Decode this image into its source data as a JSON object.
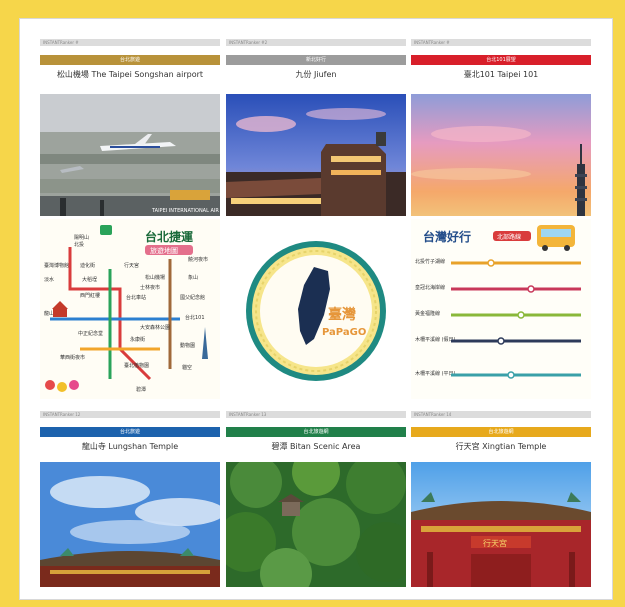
{
  "colors": {
    "page_bg": "#f6d64a",
    "gold": "#b8923a",
    "gray": "#9c9c9c",
    "red": "#d81f2a",
    "blue": "#1c62ad",
    "green": "#21804a",
    "yellow": "#e7a91c"
  },
  "row1": [
    {
      "meta": "INSTANTRanker #",
      "badge": "台北旅遊",
      "title": "松山機場 The Taipei Songshan airport"
    },
    {
      "meta": "INSTANTRanker #2",
      "badge": "新北好行",
      "title": "九份 Jiufen"
    },
    {
      "meta": "INSTANTRanker #",
      "badge": "台北101展望",
      "title": "臺北101 Taipei 101"
    }
  ],
  "airport_sign": "TAIPEI INTERNATIONAL AIR",
  "metro": {
    "title": "台北捷運",
    "subtitle": "旅遊地圖",
    "stations": [
      "陽明山",
      "北投",
      "臺灣博物館",
      "迪化街",
      "行天宮",
      "松山機場",
      "大稻埕",
      "西門紅樓",
      "台北車站",
      "大安森林公園",
      "象山",
      "龍山寺",
      "台北101",
      "中正紀念堂",
      "華西街夜市",
      "國父紀念館",
      "動物園",
      "貓空",
      "淡水",
      "士林夜市",
      "饒河夜市",
      "永康街",
      "碧潭",
      "臺北植物園"
    ]
  },
  "papago": {
    "line1": "臺灣",
    "line2": "PaPaGO"
  },
  "bus": {
    "title": "台灣好行",
    "tag": "北部路線",
    "routes": [
      "北投竹子湖線",
      "皇冠北海岸線",
      "黃金福隆線",
      "木柵平溪線 (假日)",
      "木柵平溪線 (平日)"
    ]
  },
  "row3": [
    {
      "meta": "INSTANTRanker 12",
      "badge": "台北旅遊",
      "title": "龍山寺 Lungshan Temple"
    },
    {
      "meta": "INSTANTRanker 13",
      "badge": "台北旅遊網",
      "title": "碧潭 Bitan Scenic Area"
    },
    {
      "meta": "INSTANTRanker 14",
      "badge": "台北旅遊網",
      "title": "行天宮 Xingtian Temple"
    }
  ],
  "temple_plaque": "行天宮"
}
